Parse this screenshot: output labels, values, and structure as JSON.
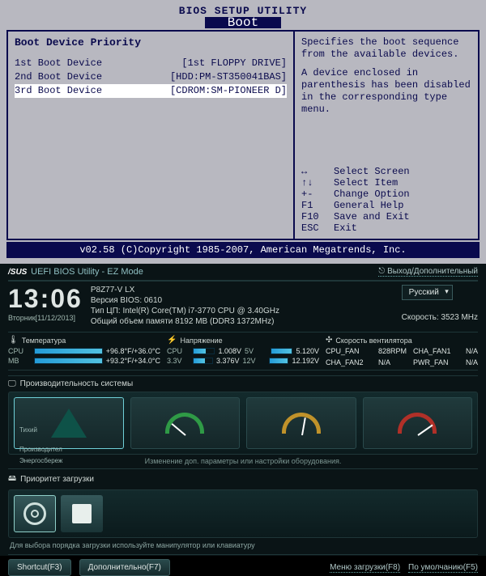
{
  "ami": {
    "title": "BIOS SETUP UTILITY",
    "tab": "Boot",
    "heading": "Boot Device Priority",
    "rows": [
      {
        "label": "1st Boot Device",
        "value": "[1st FLOPPY DRIVE]"
      },
      {
        "label": "2nd Boot Device",
        "value": "[HDD:PM-ST350041BAS]"
      },
      {
        "label": "3rd Boot Device",
        "value": "[CDROM:SM-PIONEER D]"
      }
    ],
    "desc1": "Specifies the boot sequence from the available devices.",
    "desc2": "A device enclosed in parenthesis has been disabled in the corresponding type menu.",
    "keys": [
      {
        "k": "↔",
        "v": "Select Screen"
      },
      {
        "k": "↑↓",
        "v": "Select Item"
      },
      {
        "k": "+-",
        "v": "Change Option"
      },
      {
        "k": "F1",
        "v": "General Help"
      },
      {
        "k": "F10",
        "v": "Save and Exit"
      },
      {
        "k": "ESC",
        "v": "Exit"
      }
    ],
    "footer": "v02.58 (C)Copyright 1985-2007, American Megatrends, Inc."
  },
  "uefi": {
    "logo": "/SUS",
    "subtitle": "UEFI BIOS Utility - EZ Mode",
    "exit_link": "Выход/Дополнительный",
    "clock": "13:06",
    "date": "Вторник[11/12/2013]",
    "board": "P8Z77-V LX",
    "bios_ver_label": "Версия BIOS:",
    "bios_ver": "0610",
    "cpu_label": "Тип ЦП:",
    "cpu": "Intel(R) Core(TM) i7-3770 CPU @ 3.40GHz",
    "mem_label": "Общий объем памяти",
    "mem": "8192 MB (DDR3 1372MHz)",
    "speed_label": "Скорость:",
    "speed": "3523 MHz",
    "lang": "Русский",
    "temp_title": "Температура",
    "volt_title": "Напряжение",
    "fan_title": "Скорость вентилятора",
    "temps": [
      {
        "name": "CPU",
        "value": "+96.8°F/+36.0°C"
      },
      {
        "name": "MB",
        "value": "+93.2°F/+34.0°C"
      }
    ],
    "volts": [
      {
        "name": "CPU",
        "v1": "1.008V",
        "n2": "5V",
        "v2": "5.120V"
      },
      {
        "name": "3.3V",
        "v1": "3.376V",
        "n2": "12V",
        "v2": "12.192V"
      }
    ],
    "fans": [
      {
        "name": "CPU_FAN",
        "value": "828RPM"
      },
      {
        "name": "CHA_FAN1",
        "value": "N/A"
      },
      {
        "name": "CHA_FAN2",
        "value": "N/A"
      },
      {
        "name": "PWR_FAN",
        "value": "N/A"
      }
    ],
    "perf_title": "Производительность системы",
    "perf_quiet": "Тихий",
    "perf_prod": "Производител",
    "perf_energy": "Энергосбереж",
    "perf_hint": "Изменение доп. параметры или настройки оборудования.",
    "boot_title": "Приоритет загрузки",
    "boot_hint": "Для выбора порядка загрузки используйте манипулятор или клавиатуру",
    "btn_shortcut": "Shortcut(F3)",
    "btn_advanced": "Дополнительно(F7)",
    "link_bootmenu": "Меню загрузки(F8)",
    "link_default": "По умолчанию(F5)"
  }
}
